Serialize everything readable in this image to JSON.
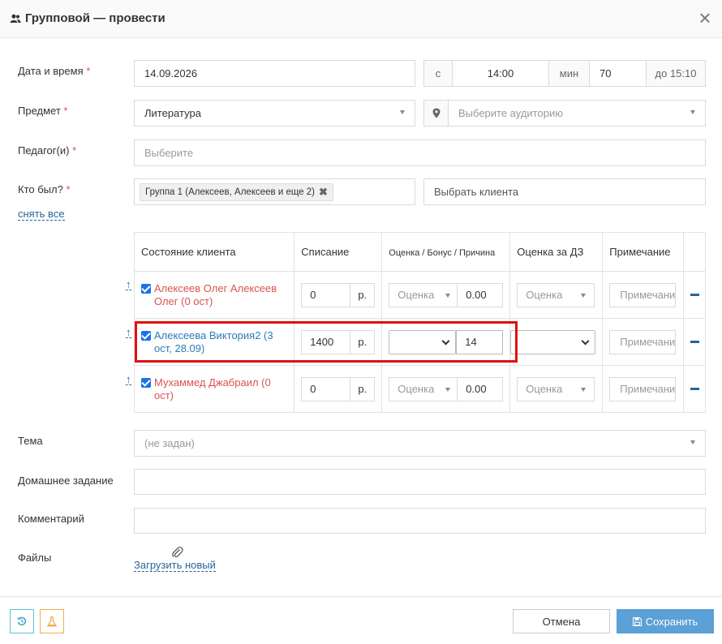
{
  "dialog": {
    "title": "Групповой — провести"
  },
  "form": {
    "datetime": {
      "label": "Дата и время",
      "required": "*",
      "date": "14.09.2026",
      "from_label": "с",
      "time": "14:00",
      "min_label": "мин",
      "minutes": "70",
      "until": "до 15:10"
    },
    "subject": {
      "label": "Предмет",
      "required": "*",
      "value": "Литература",
      "room_placeholder": "Выберите аудиторию"
    },
    "teacher": {
      "label": "Педагог(и)",
      "required": "*",
      "placeholder": "Выберите"
    },
    "attendees": {
      "label": "Кто был?",
      "required": "*",
      "group_tag": "Группа 1 (Алексеев, Алексеев и еще 2)",
      "client_placeholder": "Выбрать клиента",
      "clear_all": "снять все"
    }
  },
  "table": {
    "headers": [
      "Состояние клиента",
      "Списание",
      "Оценка / Бонус / Причина",
      "Оценка за ДЗ",
      "Примечание"
    ],
    "rows": [
      {
        "name": "Алексеев Олег Алексеев Олег (0 ост)",
        "amount": "0",
        "currency": "р.",
        "grade_placeholder": "Оценка",
        "bonus": "0.00",
        "hw_placeholder": "Оценка",
        "note_placeholder": "Примечание"
      },
      {
        "name": "Алексеева Виктория2 (3 ост, 28.09)",
        "amount": "1400",
        "currency": "р.",
        "grade_placeholder": "",
        "bonus": "14",
        "hw_placeholder": "",
        "note_placeholder": "Примечание"
      },
      {
        "name": "Мухаммед Джабраил (0 ост)",
        "amount": "0",
        "currency": "р.",
        "grade_placeholder": "Оценка",
        "bonus": "0.00",
        "hw_placeholder": "Оценка",
        "note_placeholder": "Примечание"
      }
    ]
  },
  "topic": {
    "label": "Тема",
    "placeholder": "(не задан)"
  },
  "homework": {
    "label": "Домашнее задание",
    "value": ""
  },
  "comment": {
    "label": "Комментарий",
    "value": ""
  },
  "files": {
    "label": "Файлы",
    "upload": "Загрузить новый"
  },
  "footer": {
    "cancel": "Отмена",
    "save": "Сохранить"
  },
  "colors": {
    "accent": "#5ba0d6",
    "required": "#d9534f",
    "highlight": "#e01010",
    "client_inactive": "#d9534f",
    "client_active": "#2a7bb5"
  }
}
